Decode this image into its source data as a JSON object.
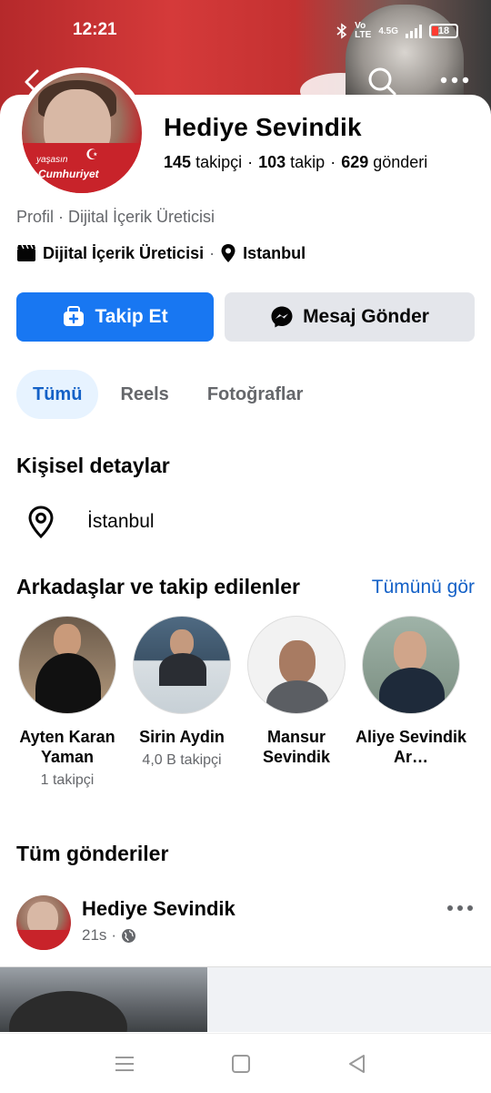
{
  "status": {
    "time": "12:21",
    "battery": "18",
    "network": "4.5G"
  },
  "profile": {
    "name": "Hediye Sevindik",
    "followers_count": "145",
    "followers_label": "takipçi",
    "following_count": "103",
    "following_label": "takip",
    "posts_count": "629",
    "posts_label": "gönderi",
    "category_line": "Profil · Dijital İçerik Üreticisi",
    "category": "Dijital İçerik Üreticisi",
    "city": "Istanbul",
    "avatar_caption_1": "yaşasın",
    "avatar_caption_2": "Cumhuriyet"
  },
  "actions": {
    "follow_label": "Takip Et",
    "message_label": "Mesaj Gönder"
  },
  "tabs": [
    {
      "label": "Tümü",
      "active": true
    },
    {
      "label": "Reels",
      "active": false
    },
    {
      "label": "Fotoğraflar",
      "active": false
    }
  ],
  "details": {
    "title": "Kişisel detaylar",
    "location": "İstanbul"
  },
  "friends_section": {
    "title": "Arkadaşlar ve takip edilenler",
    "see_all": "Tümünü gör",
    "items": [
      {
        "name": "Ayten Karan Yaman",
        "sub": "1 takipçi"
      },
      {
        "name": "Sirin Aydin",
        "sub": "4,0 B takipçi"
      },
      {
        "name": "Mansur Sevindik",
        "sub": ""
      },
      {
        "name": "Aliye Sevindik Ar…",
        "sub": ""
      }
    ]
  },
  "posts": {
    "title": "Tüm gönderiler",
    "first": {
      "author": "Hediye Sevindik",
      "time": "21s",
      "sep": "·"
    }
  },
  "icons": {
    "back": "back-arrow-icon",
    "search": "search-icon",
    "more": "more-dots-icon",
    "category": "clapperboard-icon",
    "location": "location-pin-icon",
    "follow": "add-friend-icon",
    "message": "messenger-icon",
    "globe": "globe-icon"
  },
  "colors": {
    "accent": "#1877f2",
    "link": "#1461c7",
    "secondary_text": "#65676b",
    "button_grey": "#e4e6eb"
  }
}
